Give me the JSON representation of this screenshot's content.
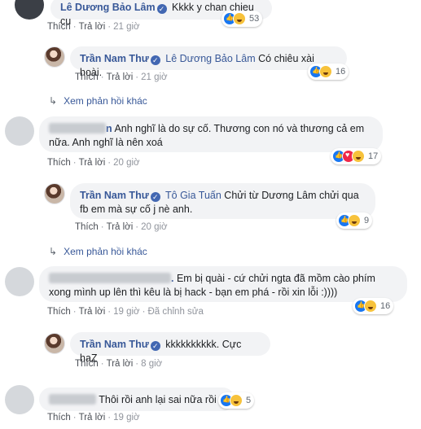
{
  "comments": [
    {
      "author": "Lê Dương Bảo Lâm",
      "verified_mark": "✓",
      "text": "Kkkk y chan chieu cu",
      "reaction_count": "53",
      "like_label": "Thích",
      "reply_label": "Trả lời",
      "time": "21 giờ"
    },
    {
      "author": "Trần Nam Thư",
      "verified_mark": "✓",
      "mention": "Lê Dương Bảo Lâm",
      "text": "Có chiêu xài hoài.",
      "reaction_count": "16",
      "like_label": "Thích",
      "reply_label": "Trả lời",
      "time": "21 giờ"
    },
    {
      "more_replies": "Xem phản hồi khác"
    },
    {
      "author_suffix": "n",
      "text_line1": "Anh nghĩ là do sự cố. Thương con nó và thương cả em",
      "text_line2": "nữa. Anh nghĩ là nên xoá",
      "reaction_count": "17",
      "like_label": "Thích",
      "reply_label": "Trả lời",
      "time": "20 giờ"
    },
    {
      "author": "Trần Nam Thư",
      "verified_mark": "✓",
      "mention": "Tô Gia Tuấn",
      "text_line1": "Chửi từ Dương Lâm chửi qua",
      "text_line2": "fb em mà sự cố j nè anh.",
      "reaction_count": "9",
      "like_label": "Thích",
      "reply_label": "Trả lời",
      "time": "20 giờ"
    },
    {
      "more_replies": "Xem phản hồi khác"
    },
    {
      "author_suffix": ".",
      "text_line1": "Em bị quài - cứ chửi ngta đã mồm cào phím",
      "text_line2": "xong mình up lên thì kêu là bị hack - bạn em phá - rồi xin lỗi :))))",
      "reaction_count": "16",
      "like_label": "Thích",
      "reply_label": "Trả lời",
      "time": "19 giờ",
      "edited": "Đã chỉnh sửa"
    },
    {
      "author": "Trần Nam Thư",
      "verified_mark": "✓",
      "text": "kkkkkkkkkk. Cực haZ",
      "like_label": "Thích",
      "reply_label": "Trả lời",
      "time": "8 giờ"
    },
    {
      "text": "Thôi rồi anh lại sai nữa rồi",
      "reaction_count": "5",
      "like_label": "Thích",
      "reply_label": "Trả lời",
      "time": "19 giờ"
    }
  ],
  "colors": {
    "link": "#385898",
    "bubble": "#f2f3f5",
    "meta": "#606770",
    "like_blue": "#1877f2",
    "haha_yellow": "#f7c23b",
    "love_red": "#f0284a"
  }
}
